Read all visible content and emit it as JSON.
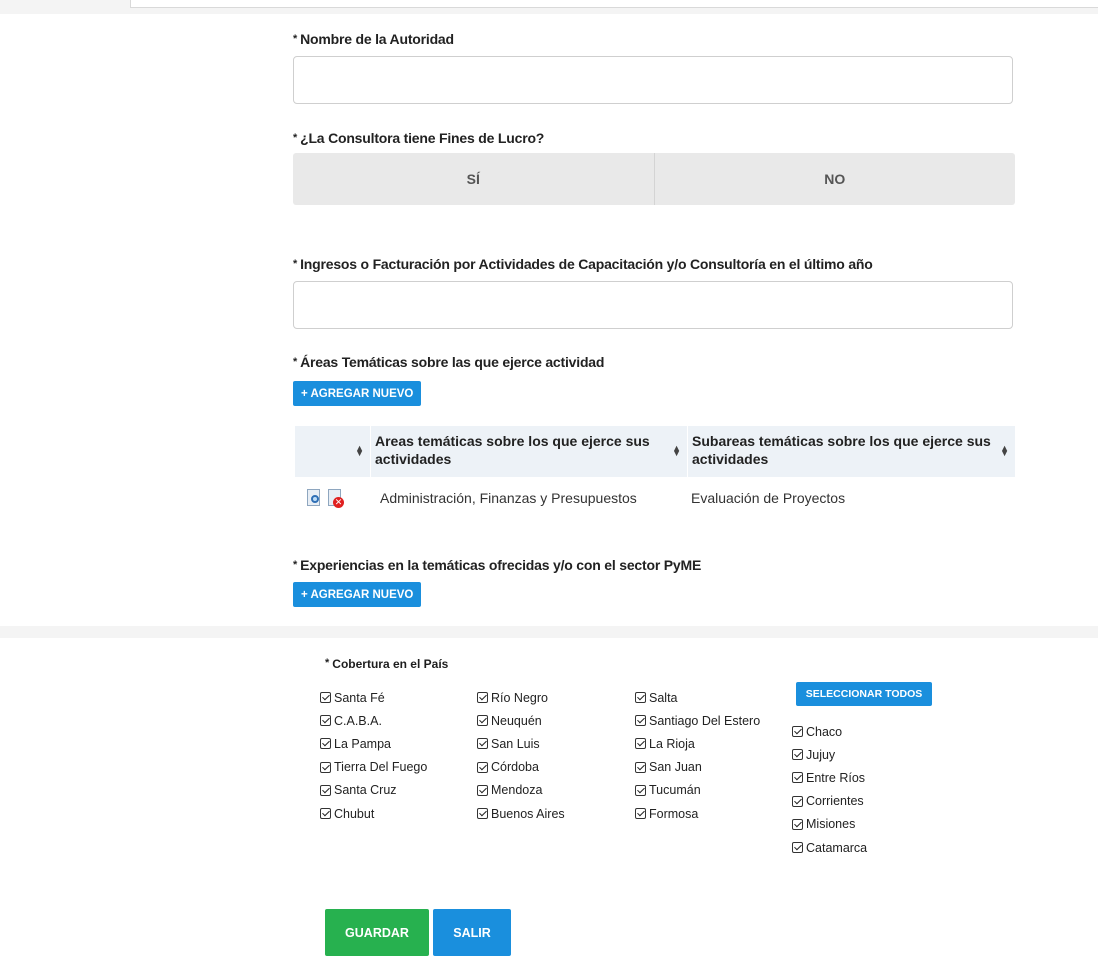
{
  "form": {
    "autoridad_label": "Nombre de la Autoridad",
    "autoridad_value": "",
    "lucro_label": "¿La Consultora tiene Fines de Lucro?",
    "lucro_si": "SÍ",
    "lucro_no": "NO",
    "ingresos_label": "Ingresos o Facturación por Actividades de Capacitación y/o Consultoría en el último año",
    "ingresos_value": "",
    "areas_label": "Áreas Temáticas sobre las que ejerce actividad",
    "add_new_label": "+ AGREGAR NUEVO",
    "experiencias_label": "Experiencias en la temáticas ofrecidas y/o con el sector PyME",
    "required_marker": "*"
  },
  "table": {
    "headers": [
      "Areas temáticas sobre los que ejerce sus actividades",
      "Subareas temáticas sobre los que ejerce sus actividades"
    ],
    "rows": [
      [
        "Administración, Finanzas y Presupuestos",
        "Evaluación de Proyectos"
      ]
    ]
  },
  "coverage": {
    "title": "Cobertura en el País",
    "select_all_label": "SELECCIONAR TODOS",
    "col1": [
      "Santa Fé",
      "C.A.B.A.",
      "La Pampa",
      "Tierra Del Fuego",
      "Santa Cruz",
      "Chubut"
    ],
    "col2": [
      "Río Negro",
      "Neuquén",
      "San Luis",
      "Córdoba",
      "Mendoza",
      "Buenos Aires"
    ],
    "col3": [
      "Salta",
      "Santiago Del Estero",
      "La Rioja",
      "San Juan",
      "Tucumán",
      "Formosa"
    ],
    "col4": [
      "Chaco",
      "Jujuy",
      "Entre Ríos",
      "Corrientes",
      "Misiones",
      "Catamarca"
    ]
  },
  "actions": {
    "save_label": "GUARDAR",
    "exit_label": "SALIR"
  },
  "colors": {
    "primary": "#1a8fdd",
    "success": "#27b14f",
    "toggle_bg": "#e9e9e9",
    "table_header_bg": "#edf2f7"
  },
  "icons": {
    "edit": "view-edit-icon",
    "delete": "delete-icon",
    "sort": "sort-icon",
    "checkbox": "checked-checkbox-icon"
  }
}
